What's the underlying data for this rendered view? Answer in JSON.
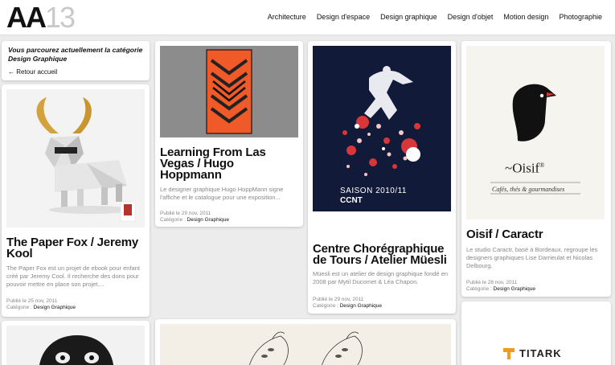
{
  "header": {
    "logo_main": "AA",
    "logo_num": "13",
    "nav": [
      "Architecture",
      "Design d'espace",
      "Design graphique",
      "Design d'objet",
      "Motion design",
      "Photographie"
    ]
  },
  "intro": {
    "text": "Vous parcourez actuellement la catégorie Design Graphique",
    "back": "← Retour accueil"
  },
  "posts": [
    {
      "title": "The Paper Fox / Jeremy Kool",
      "excerpt": "The Paper Fox est un projet de ebook pour enfant créé par Jeremy Cool. Il recherche des dons pour pouvoir mettre en place son projet....",
      "date": "Publié le 25 nov, 2011",
      "category_prefix": "Catégorie : ",
      "category": "Design Graphique"
    },
    {
      "title": "Learning From Las Vegas / Hugo Hoppmann",
      "excerpt": "Le designer graphique Hugo HoppMann signe l'affiche et le catalogue pour une exposition...",
      "date": "Publié le 29 nov, 2011",
      "category_prefix": "Catégorie : ",
      "category": "Design Graphique"
    },
    {
      "title": "Centre Chorégraphique de Tours / Atelier Müesli",
      "excerpt": "Müesli est un atelier de design graphique fondé en 2008 par Mytil Ducomet & Léa Chapon.",
      "date": "Publié le 29 nov, 2011",
      "category_prefix": "Catégorie : ",
      "category": "Design Graphique"
    },
    {
      "title": "Oisif / Caractr",
      "excerpt": "Le studio Caractr, basé à Bordeaux, regroupe les designers graphiques Lise Darrieulat et Nicolas Delbourg.",
      "date": "Publié le 28 nov, 2011",
      "category_prefix": "Catégorie : ",
      "category": "Design Graphique"
    }
  ],
  "poster_texts": {
    "saison": "SAISON",
    "saison_years": "2010/11",
    "ccnt": "CCNT",
    "oisif": "~Oisif",
    "oisif_reg": "®",
    "oisif_tagline": "Cafés, thés & gourmandises",
    "titark": "TITARK"
  },
  "colors": {
    "background": "#ececec",
    "card": "#ffffff",
    "text_dark": "#111111",
    "text_muted": "#888888",
    "logo_num": "#c9c9c9",
    "vegas_orange": "#f05a28",
    "muesli_red": "#d8363a",
    "titark_orange": "#f39a1e"
  }
}
